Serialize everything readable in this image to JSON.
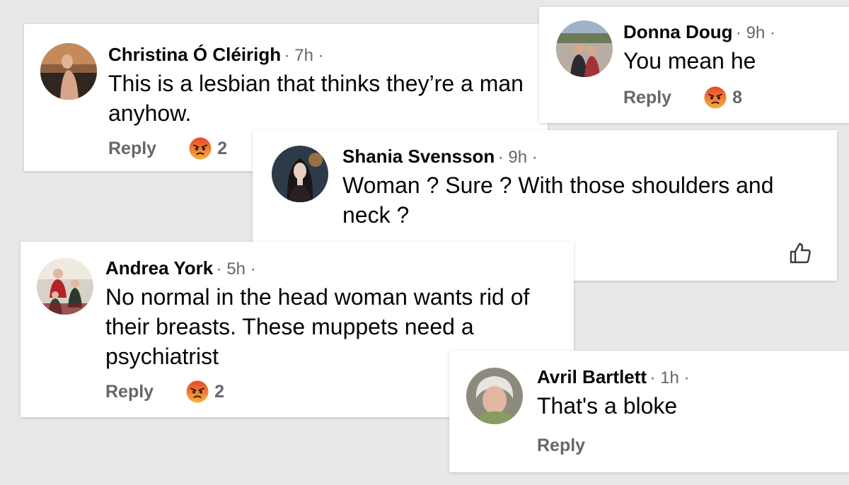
{
  "comments": [
    {
      "id": "christina",
      "name": "Christina Ó Cléirigh",
      "time": "· 7h ·",
      "text": "This is a lesbian that thinks they’re a man anyhow.",
      "reply_label": "Reply",
      "reaction": "angry-emoji",
      "reaction_count": "2"
    },
    {
      "id": "donna",
      "name": "Donna Doug",
      "time": "· 9h ·",
      "text": "You mean he",
      "reply_label": "Reply",
      "reaction": "angry-emoji",
      "reaction_count": "8"
    },
    {
      "id": "shania",
      "name": "Shania Svensson",
      "time": "· 9h ·",
      "text": "Woman ?  Sure ?  With those shoulders and neck ?",
      "reaction": "thumbs-up-icon"
    },
    {
      "id": "andrea",
      "name": "Andrea York",
      "time": "· 5h ·",
      "text": "No normal in the head woman wants rid of their breasts. These muppets need a psychiatrist",
      "reply_label": "Reply",
      "reaction": "angry-emoji",
      "reaction_count": "2"
    },
    {
      "id": "avril",
      "name": "Avril Bartlett",
      "time": "· 1h ·",
      "text": "That's a bloke",
      "reply_label": "Reply"
    }
  ],
  "colors": {
    "background": "#e9e8e8",
    "card": "#ffffff",
    "name": "#050505",
    "meta": "#65676b",
    "angry_top": "#e8482b",
    "angry_bottom": "#f3a23b"
  }
}
